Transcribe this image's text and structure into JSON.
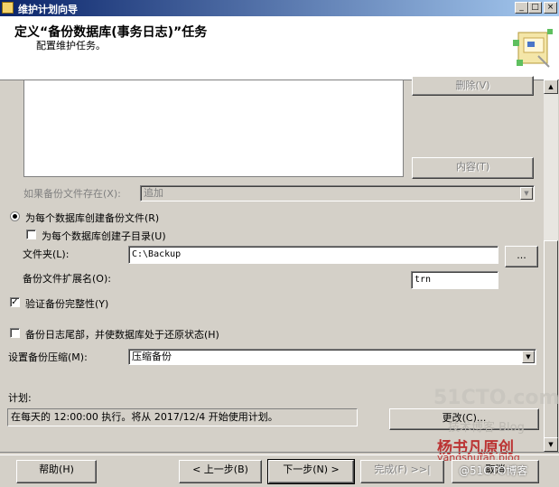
{
  "window": {
    "title": "维护计划向导",
    "min": "_",
    "max": "□",
    "close": "×"
  },
  "header": {
    "title": "定义“备份数据库(事务日志)”任务",
    "subtitle": "配置维护任务。"
  },
  "buttons": {
    "remove": "删除(V)",
    "contents": "内容(T)",
    "browse": "...",
    "change": "更改(C)...",
    "help": "帮助(H)",
    "back": "< 上一步(B)",
    "next": "下一步(N) >",
    "finish": "完成(F) >>|",
    "cancel": "取消"
  },
  "form": {
    "if_exists_label": "如果备份文件存在(X):",
    "if_exists_value": "追加",
    "per_db_file_label": "为每个数据库创建备份文件(R)",
    "per_db_subdir_label": "为每个数据库创建子目录(U)",
    "folder_label": "文件夹(L):",
    "folder_value": "C:\\Backup",
    "ext_label": "备份文件扩展名(O):",
    "ext_value": "trn",
    "verify_label": "验证备份完整性(Y)",
    "verify_checked": true,
    "tail_log_label": "备份日志尾部，并使数据库处于还原状态(H)",
    "tail_log_checked": false,
    "compression_label": "设置备份压缩(M):",
    "compression_value": "压缩备份",
    "schedule_label": "计划:",
    "schedule_value": "在每天的 12:00:00 执行。将从 2017/12/4 开始使用计划。"
  },
  "watermarks": {
    "site": "51CTO.com",
    "tech": "技术博客 Blog",
    "author": "杨书凡原创",
    "url": "yangshufan.blog",
    "blog": "@51CTO博客"
  }
}
